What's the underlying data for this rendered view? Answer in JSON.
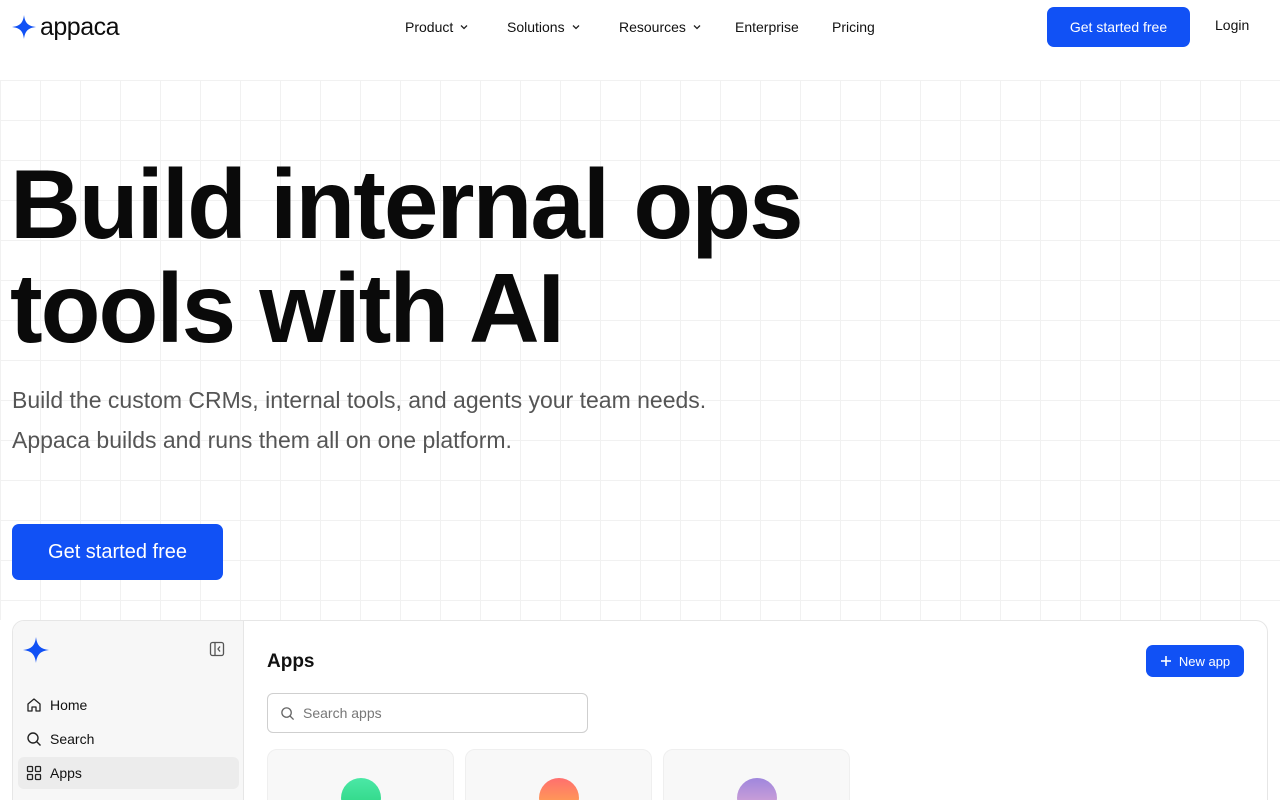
{
  "brand": {
    "name": "appaca",
    "accent": "#1151f5"
  },
  "nav": {
    "links": [
      {
        "label": "Product",
        "has_menu": true
      },
      {
        "label": "Solutions",
        "has_menu": true
      },
      {
        "label": "Resources",
        "has_menu": true
      },
      {
        "label": "Enterprise",
        "has_menu": false
      },
      {
        "label": "Pricing",
        "has_menu": false
      }
    ],
    "cta_label": "Get started free",
    "login_label": "Login"
  },
  "hero": {
    "title_line1": "Build internal ops",
    "title_line2": "tools with AI",
    "subtitle": "Build the custom CRMs, internal tools, and agents your team needs. Appaca builds and runs them all on one platform.",
    "cta_label": "Get started free"
  },
  "app_preview": {
    "sidebar": {
      "items": [
        {
          "label": "Home",
          "icon": "home-icon",
          "active": false
        },
        {
          "label": "Search",
          "icon": "search-icon",
          "active": false
        },
        {
          "label": "Apps",
          "icon": "grid-icon",
          "active": true
        }
      ]
    },
    "main": {
      "title": "Apps",
      "new_app_label": "New app",
      "search_placeholder": "Search apps",
      "cards": [
        {
          "gradient": [
            "#3fe0a0",
            "#2fd67a"
          ]
        },
        {
          "gradient": [
            "#ff7a6a",
            "#ffb04a"
          ]
        },
        {
          "gradient": [
            "#a98be0",
            "#e2a8d6"
          ]
        }
      ]
    }
  }
}
